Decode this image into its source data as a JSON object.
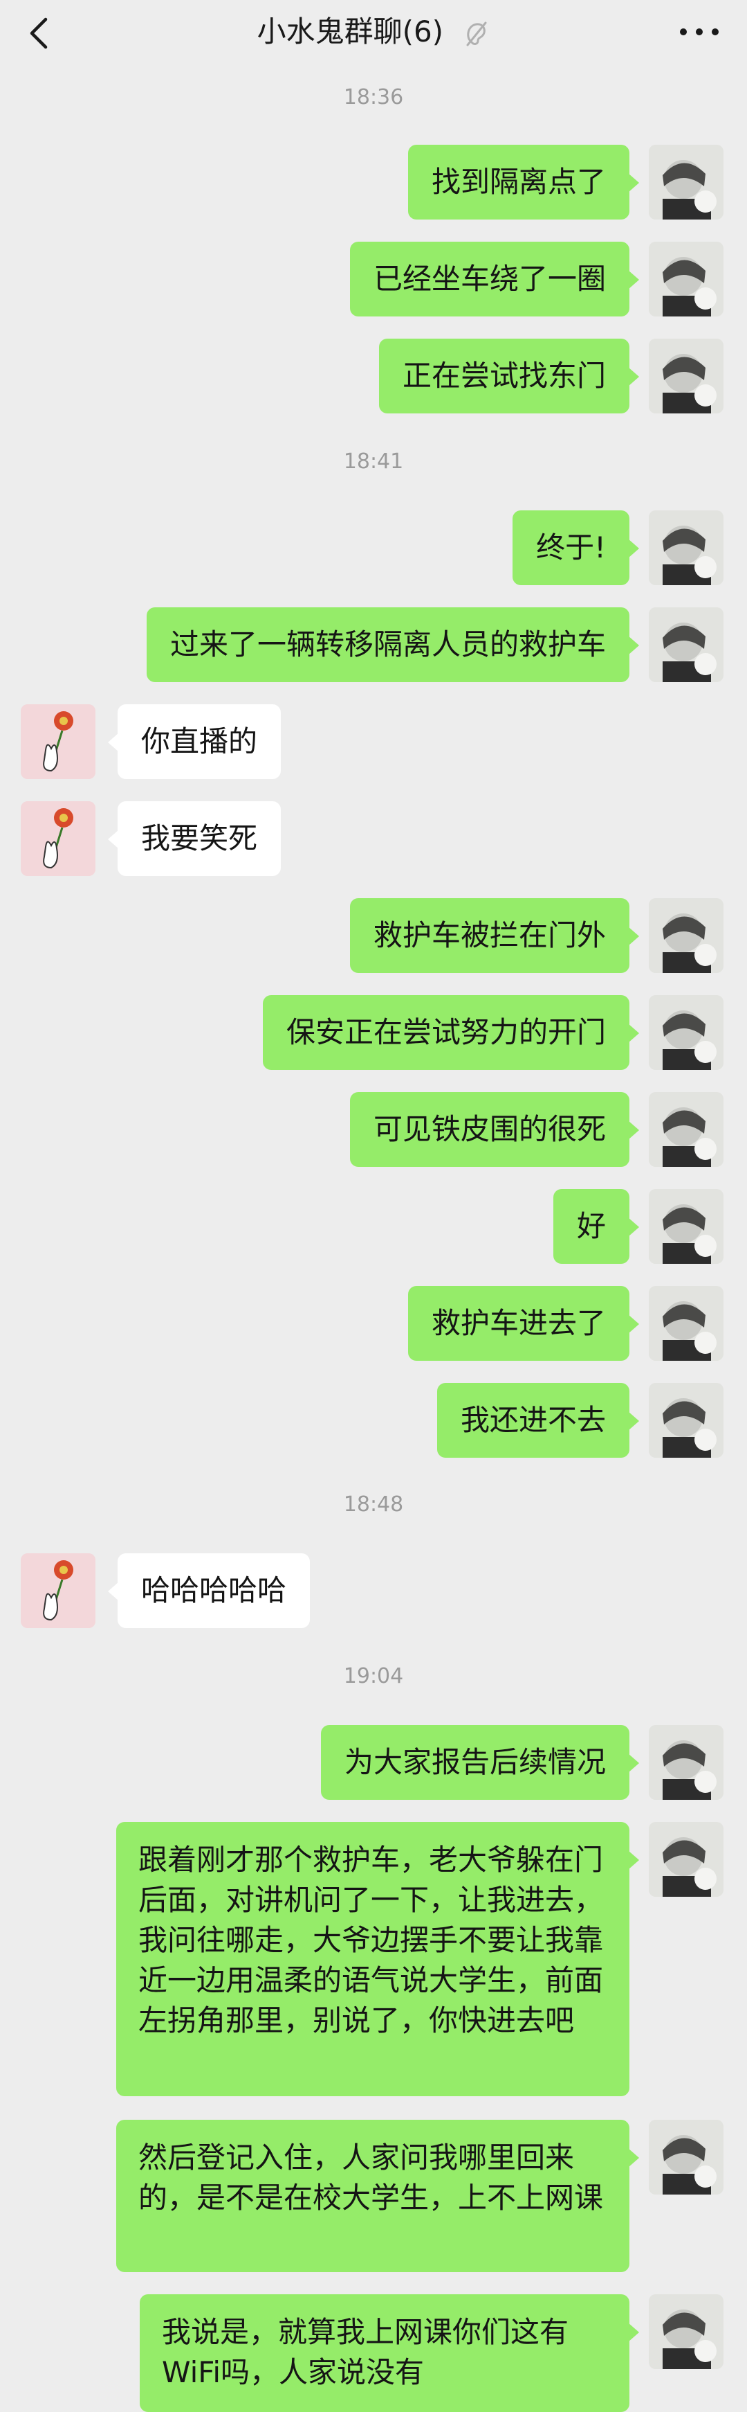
{
  "header": {
    "title": "小水鬼群聊(6)",
    "back_icon": "chevron-left-icon",
    "mute_icon": "mute-ear-icon",
    "more_icon": "more-dots-icon"
  },
  "timestamps": [
    "18:36",
    "18:41",
    "18:48",
    "19:04"
  ],
  "messages": [
    {
      "side": "me",
      "text": "找到隔离点了"
    },
    {
      "side": "me",
      "text": "已经坐车绕了一圈"
    },
    {
      "side": "me",
      "text": "正在尝试找东门"
    },
    {
      "side": "me",
      "text": "终于!"
    },
    {
      "side": "me",
      "text": "过来了一辆转移隔离人员的救护车"
    },
    {
      "side": "other",
      "text": "你直播的"
    },
    {
      "side": "other",
      "text": "我要笑死"
    },
    {
      "side": "me",
      "text": "救护车被拦在门外"
    },
    {
      "side": "me",
      "text": "保安正在尝试努力的开门"
    },
    {
      "side": "me",
      "text": "可见铁皮围的很死"
    },
    {
      "side": "me",
      "text": "好"
    },
    {
      "side": "me",
      "text": "救护车进去了"
    },
    {
      "side": "me",
      "text": "我还进不去"
    },
    {
      "side": "other",
      "text": "哈哈哈哈哈"
    },
    {
      "side": "me",
      "text": "为大家报告后续情况"
    },
    {
      "side": "me",
      "text": "跟着刚才那个救护车，老大爷躲在门后面，对讲机问了一下，让我进去，我问往哪走，大爷边摆手不要让我靠近一边用温柔的语气说大学生，前面左拐角那里，别说了，你快进去吧"
    },
    {
      "side": "me",
      "text": "然后登记入住，人家问我哪里回来的，是不是在校大学生，上不上网课"
    },
    {
      "side": "me",
      "text": "我说是，就算我上网课你们这有WiFi吗，人家说没有"
    }
  ],
  "colors": {
    "background": "#ededed",
    "my_bubble": "#95ec69",
    "other_bubble": "#ffffff",
    "timestamp": "#9a9a9a"
  }
}
